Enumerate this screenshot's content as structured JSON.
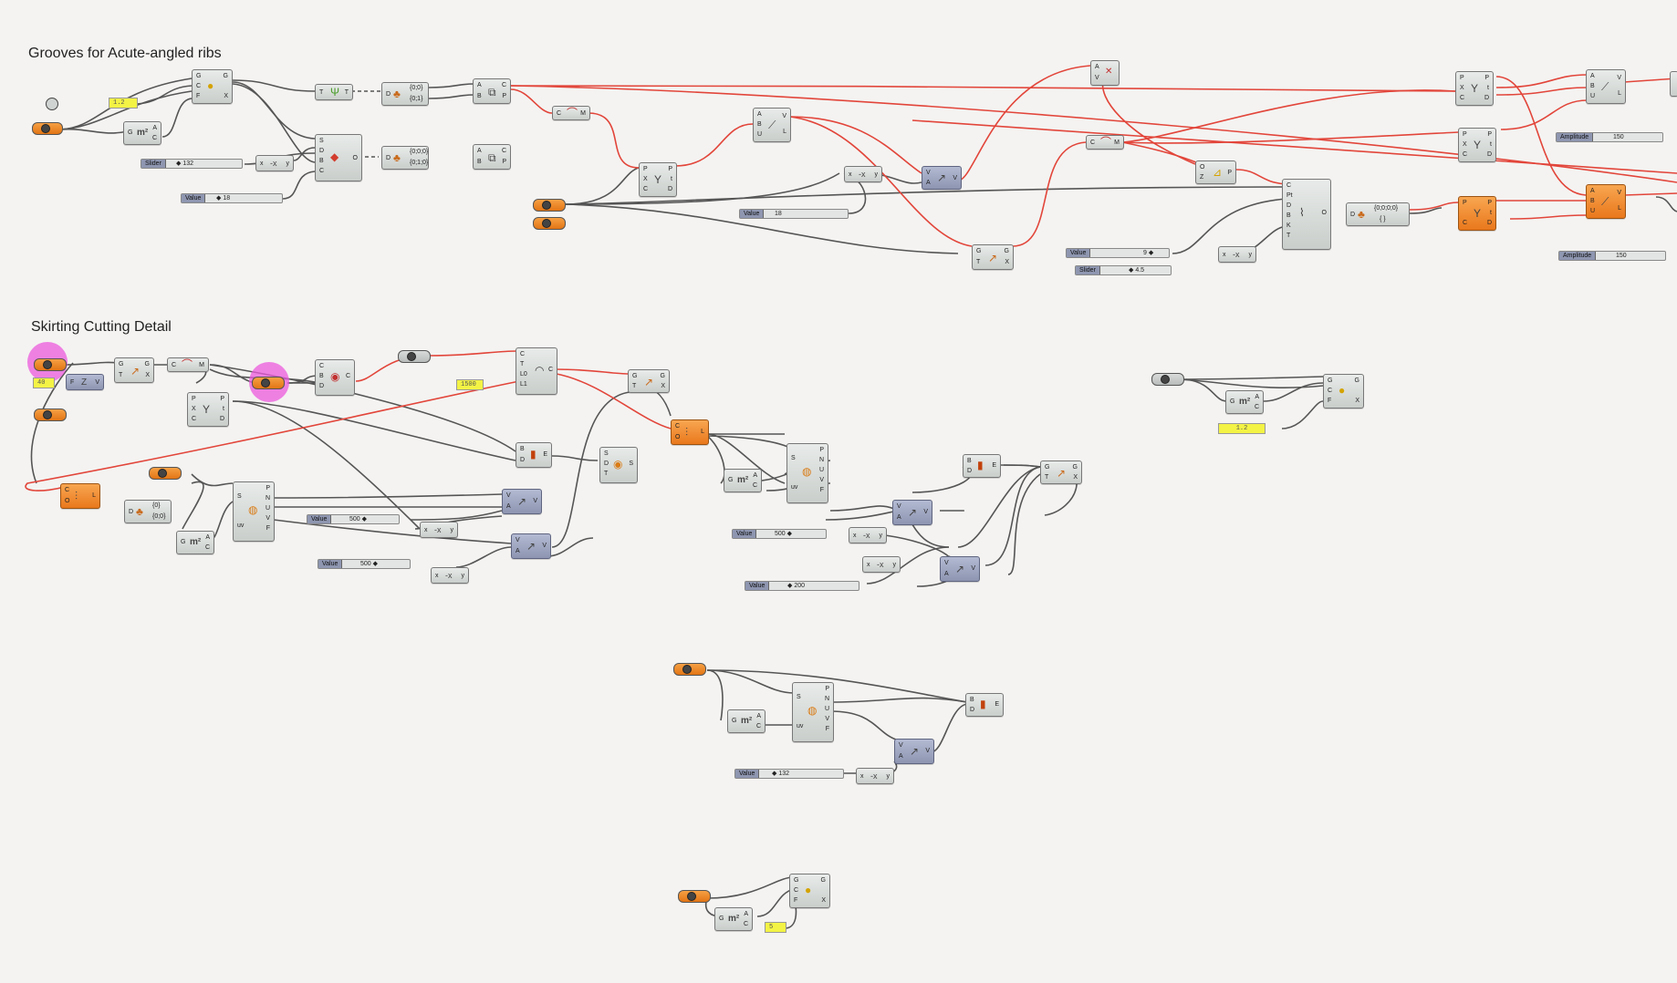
{
  "groups": {
    "grooves_title": "Grooves for Acute-angled ribs",
    "skirting_title": "Skirting Cutting Detail"
  },
  "panels": {
    "p1": "1.2",
    "p2": "40",
    "p3": "1500",
    "p4": "1.2",
    "p5": "5"
  },
  "sliders": [
    {
      "label": "Slider",
      "value": "◆ 132"
    },
    {
      "label": "Value",
      "value": "◆ 18"
    },
    {
      "label": "Value",
      "value": "18"
    },
    {
      "label": "Value",
      "value": "9 ◆"
    },
    {
      "label": "Slider",
      "value": "◆ 4.5"
    },
    {
      "label": "Amplitude",
      "value": "150"
    },
    {
      "label": "Amplitude",
      "value": "150"
    },
    {
      "label": "Value",
      "value": "500 ◆"
    },
    {
      "label": "Value",
      "value": "500 ◆"
    },
    {
      "label": "Value",
      "value": "500 ◆"
    },
    {
      "label": "Value",
      "value": "◆ 200"
    },
    {
      "label": "Value",
      "value": "◆ 132"
    }
  ],
  "data_tags": {
    "t1": "{0;0}",
    "t2": "{0;1}",
    "t3": "{0;0;0}",
    "t4": "{0;1;0}",
    "t5": "{0;0;0;0}",
    "t6": "{ }",
    "t7": "{0}",
    "t8": "{0;0}"
  },
  "colors": {
    "background": "#f4f3f1",
    "wire_grey": "#555555",
    "wire_red": "#e2453a",
    "component_orange": "#ee8a2c",
    "component_blue": "#9aa1bd",
    "panel_yellow": "#f3f345",
    "highlight_pink": "#ec5adc"
  }
}
